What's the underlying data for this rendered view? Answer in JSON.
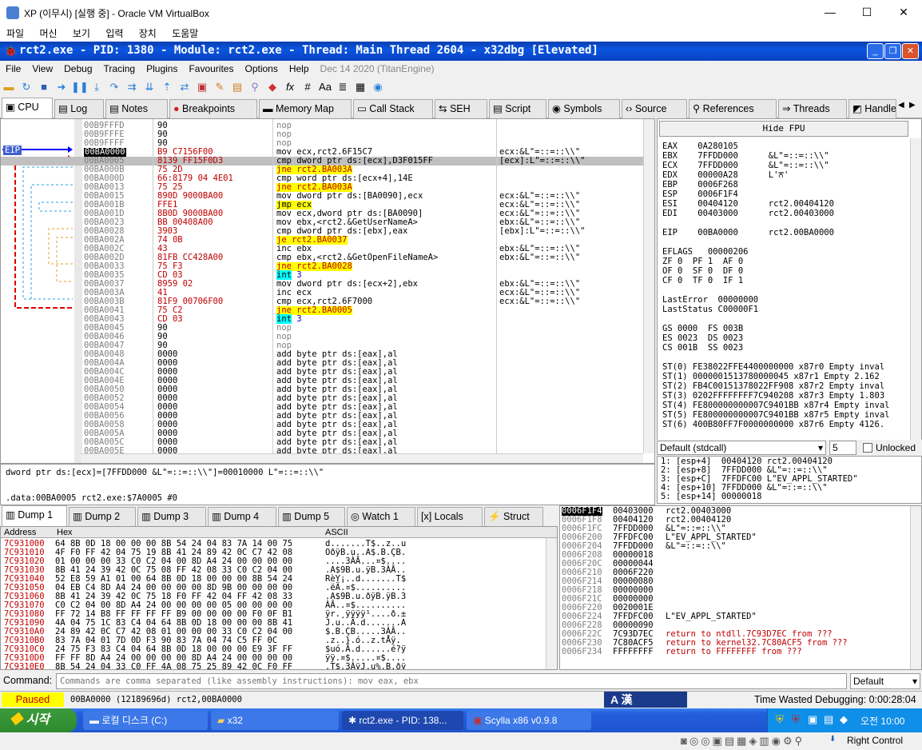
{
  "host": {
    "title": "XP (이무시) [실행 중] - Oracle VM VirtualBox",
    "menu": [
      "파일",
      "머신",
      "보기",
      "입력",
      "장치",
      "도움말"
    ]
  },
  "x64dbg": {
    "title": "rct2.exe - PID: 1380 - Module: rct2.exe - Thread: Main Thread 2604 - x32dbg [Elevated]",
    "menu": [
      "File",
      "View",
      "Debug",
      "Tracing",
      "Plugins",
      "Favourites",
      "Options",
      "Help"
    ],
    "date": "Dec 14 2020 (TitanEngine)"
  },
  "tabs": [
    "CPU",
    "Log",
    "Notes",
    "Breakpoints",
    "Memory Map",
    "Call Stack",
    "SEH",
    "Script",
    "Symbols",
    "Source",
    "References",
    "Threads",
    "Handles"
  ],
  "eip_label": "EIP",
  "disasm": [
    {
      "a": "00B9FFFD",
      "b": "90",
      "i": "nop",
      "c": ""
    },
    {
      "a": "00B9FFFE",
      "b": "90",
      "i": "nop",
      "c": ""
    },
    {
      "a": "00B9FFFF",
      "b": "90",
      "i": "nop",
      "c": ""
    },
    {
      "a": "00BA0000",
      "b": "B9 C7156F00",
      "i": "mov ecx,rct2.6F15C7",
      "c": "ecx:&L\"=::=::\\\\\""
    },
    {
      "a": "00BA0005",
      "b": "8139 FF15F0D3",
      "i": "cmp dword ptr ds:[ecx],D3F015FF",
      "c": "[ecx]:L\"=::=::\\\\\""
    },
    {
      "a": "00BA000B",
      "b": "75 2D",
      "i": "jne rct2.BA003A",
      "c": ""
    },
    {
      "a": "00BA000D",
      "b": "66:8179 04 4E01",
      "i": "cmp word ptr ds:[ecx+4],14E",
      "c": ""
    },
    {
      "a": "00BA0013",
      "b": "75 25",
      "i": "jne rct2.BA003A",
      "c": ""
    },
    {
      "a": "00BA0015",
      "b": "890D 9000BA00",
      "i": "mov dword ptr ds:[BA0090],ecx",
      "c": "ecx:&L\"=::=::\\\\\""
    },
    {
      "a": "00BA001B",
      "b": "FFE1",
      "i": "jmp ecx",
      "c": "ecx:&L\"=::=::\\\\\""
    },
    {
      "a": "00BA001D",
      "b": "8B0D 9000BA00",
      "i": "mov ecx,dword ptr ds:[BA0090]",
      "c": "ecx:&L\"=::=::\\\\\""
    },
    {
      "a": "00BA0023",
      "b": "BB 00408A00",
      "i": "mov ebx,<rct2.&GetUserNameA>",
      "c": "ebx:&L\"=::=::\\\\\""
    },
    {
      "a": "00BA0028",
      "b": "3903",
      "i": "cmp dword ptr ds:[ebx],eax",
      "c": "[ebx]:L\"=::=::\\\\\""
    },
    {
      "a": "00BA002A",
      "b": "74 0B",
      "i": "je rct2.BA0037",
      "c": ""
    },
    {
      "a": "00BA002C",
      "b": "43",
      "i": "inc ebx",
      "c": "ebx:&L\"=::=::\\\\\""
    },
    {
      "a": "00BA002D",
      "b": "81FB CC428A00",
      "i": "cmp ebx,<rct2.&GetOpenFileNameA>",
      "c": "ebx:&L\"=::=::\\\\\""
    },
    {
      "a": "00BA0033",
      "b": "75 F3",
      "i": "jne rct2.BA0028",
      "c": ""
    },
    {
      "a": "00BA0035",
      "b": "CD 03",
      "i": "int 3",
      "c": ""
    },
    {
      "a": "00BA0037",
      "b": "8959 02",
      "i": "mov dword ptr ds:[ecx+2],ebx",
      "c": "ebx:&L\"=::=::\\\\\""
    },
    {
      "a": "00BA003A",
      "b": "41",
      "i": "inc ecx",
      "c": "ecx:&L\"=::=::\\\\\""
    },
    {
      "a": "00BA003B",
      "b": "81F9 00706F00",
      "i": "cmp ecx,rct2.6F7000",
      "c": "ecx:&L\"=::=::\\\\\""
    },
    {
      "a": "00BA0041",
      "b": "75 C2",
      "i": "jne rct2.BA0005",
      "c": ""
    },
    {
      "a": "00BA0043",
      "b": "CD 03",
      "i": "int 3",
      "c": ""
    },
    {
      "a": "00BA0045",
      "b": "90",
      "i": "nop",
      "c": ""
    },
    {
      "a": "00BA0046",
      "b": "90",
      "i": "nop",
      "c": ""
    },
    {
      "a": "00BA0047",
      "b": "90",
      "i": "nop",
      "c": ""
    },
    {
      "a": "00BA0048",
      "b": "0000",
      "i": "add byte ptr ds:[eax],al",
      "c": ""
    },
    {
      "a": "00BA004A",
      "b": "0000",
      "i": "add byte ptr ds:[eax],al",
      "c": ""
    },
    {
      "a": "00BA004C",
      "b": "0000",
      "i": "add byte ptr ds:[eax],al",
      "c": ""
    },
    {
      "a": "00BA004E",
      "b": "0000",
      "i": "add byte ptr ds:[eax],al",
      "c": ""
    },
    {
      "a": "00BA0050",
      "b": "0000",
      "i": "add byte ptr ds:[eax],al",
      "c": ""
    },
    {
      "a": "00BA0052",
      "b": "0000",
      "i": "add byte ptr ds:[eax],al",
      "c": ""
    },
    {
      "a": "00BA0054",
      "b": "0000",
      "i": "add byte ptr ds:[eax],al",
      "c": ""
    },
    {
      "a": "00BA0056",
      "b": "0000",
      "i": "add byte ptr ds:[eax],al",
      "c": ""
    },
    {
      "a": "00BA0058",
      "b": "0000",
      "i": "add byte ptr ds:[eax],al",
      "c": ""
    },
    {
      "a": "00BA005A",
      "b": "0000",
      "i": "add byte ptr ds:[eax],al",
      "c": ""
    },
    {
      "a": "00BA005C",
      "b": "0000",
      "i": "add byte ptr ds:[eax],al",
      "c": ""
    },
    {
      "a": "00BA005E",
      "b": "0000",
      "i": "add byte ptr ds:[eax],al",
      "c": ""
    }
  ],
  "registers": {
    "hide_fpu": "Hide FPU",
    "lines": [
      "EAX    0A280105",
      "EBX    7FFDD000      &L\"=::=::\\\\\"",
      "ECX    7FFDD000      &L\"=::=::\\\\\"",
      "EDX    00000A28      L'ਨ'",
      "EBP    0006F268",
      "ESP    0006F1F4",
      "ESI    00404120      rct2.00404120",
      "EDI    00403000      rct2.00403000",
      "",
      "EIP    00BA0000      rct2.00BA0000",
      "",
      "EFLAGS   00000206",
      "ZF 0  PF 1  AF 0",
      "OF 0  SF 0  DF 0",
      "CF 0  TF 0  IF 1",
      "",
      "LastError  00000000",
      "LastStatus C00000F1",
      "",
      "GS 0000  FS 003B",
      "ES 0023  DS 0023",
      "CS 001B  SS 0023",
      "",
      "ST(0) FE38022FFE4400000000 x87r0 Empty inval",
      "ST(1) 0000001513780000045 x87r1 Empty 2.162",
      "ST(2) FB4C00151378022FF908 x87r2 Empty inval",
      "ST(3) 0202FFFFFFFF7C940208 x87r3 Empty 1.803",
      "ST(4) FE800000000007C9401BB x87r4 Empty inval",
      "ST(5) FE800000000007C9401BB x87r5 Empty inval",
      "ST(6) 400B80FF7F0000000000 x87r6 Empty 4126."
    ]
  },
  "callconv": {
    "value": "Default (stdcall)",
    "count": "5",
    "unlocked": "Unlocked"
  },
  "stackargs": [
    "1: [esp+4]  00404120 rct2.00404120",
    "2: [esp+8]  7FFDD000 &L\"=::=::\\\\\"",
    "3: [esp+C]  7FFDFC00 L\"EV_APPL_STARTED\"",
    "4: [esp+10] 7FFDD000 &L\"=::=::\\\\\"",
    "5: [esp+14] 00000018"
  ],
  "info": [
    "dword ptr ds:[ecx]=[7FFDD000 &L\"=::=::\\\\\"]=00010000 L\"=::=::\\\\\"",
    "",
    ".data:00BA0005 rct2.exe:$7A0005 #0"
  ],
  "dumptabs": [
    "Dump 1",
    "Dump 2",
    "Dump 3",
    "Dump 4",
    "Dump 5",
    "Watch 1",
    "Locals",
    "Struct"
  ],
  "dump": {
    "h_addr": "Address",
    "h_hex": "Hex",
    "h_ascii": "ASCII",
    "rows": [
      {
        "a": "7C931000",
        "h": "64 8B 0D 18 00 00 00 8B 54 24 04 83 7A 14 00 75",
        "s": "d.......T$..z..u"
      },
      {
        "a": "7C931010",
        "h": "4F F0 FF 42 04 75 19 8B 41 24 89 42 0C C7 42 08",
        "s": "OðÿB.u..A$.B.ÇB."
      },
      {
        "a": "7C931020",
        "h": "01 00 00 00 33 C0 C2 04 00 8D A4 24 00 00 00 00",
        "s": "....3ÀÂ...¤$...."
      },
      {
        "a": "7C931030",
        "h": "8B 41 24 39 42 0C 75 08 FF 42 08 33 C0 C2 04 00",
        "s": ".A$9B.u.ÿB.3ÀÂ.."
      },
      {
        "a": "7C931040",
        "h": "52 E8 59 A1 01 00 64 8B 0D 18 00 00 00 8B 54 24",
        "s": "RèY¡..d.......T$"
      },
      {
        "a": "7C931050",
        "h": "04 EB C4 8D A4 24 00 00 00 00 8D 9B 00 00 00 00",
        "s": ".ëÄ.¤$.........."
      },
      {
        "a": "7C931060",
        "h": "8B 41 24 39 42 0C 75 18 F0 FF 42 04 FF 42 08 33",
        "s": ".A$9B.u.ðÿB.ÿB.3"
      },
      {
        "a": "7C931070",
        "h": "C0 C2 04 00 8D A4 24 00 00 00 00 05 00 00 00 00",
        "s": "ÀÂ..¤$.........."
      },
      {
        "a": "7C931080",
        "h": "FF 72 14 B8 FF FF FF FF B9 00 00 00 00 F0 0F B1",
        "s": "ÿr.¸ÿÿÿÿ¹....ð.±"
      },
      {
        "a": "7C931090",
        "h": "4A 04 75 1C 83 C4 04 64 8B 0D 18 00 00 00 8B 41",
        "s": "J.u..Ä.d.......A"
      },
      {
        "a": "7C9310A0",
        "h": "24 89 42 0C C7 42 08 01 00 00 00 33 C0 C2 04 00",
        "s": "$.B.ÇB.....3ÀÂ.."
      },
      {
        "a": "7C9310B0",
        "h": "83 7A 04 01 7D 0D F3 90 83 7A 04 74 C5 FF 0C",
        "s": ".z..}.ó..z.tÅÿ."
      },
      {
        "a": "7C9310C0",
        "h": "24 75 F3 83 C4 04 64 8B 0D 18 00 00 00 E9 3F FF",
        "s": "$uó.Ä.d......é?ÿ"
      },
      {
        "a": "7C9310D0",
        "h": "FF FF 8D A4 24 00 00 00 00 8D A4 24 00 00 00 00",
        "s": "ÿÿ.¤$.....¤$...."
      },
      {
        "a": "7C9310E0",
        "h": "8B 54 24 04 33 C0 FF 4A 08 75 25 89 42 0C F0 FF",
        "s": ".T$.3ÀÿJ.u%.B.ðÿ"
      }
    ]
  },
  "stack": [
    {
      "a": "0006F1F4",
      "v": "00403000",
      "c": "rct2.00403000"
    },
    {
      "a": "0006F1F8",
      "v": "00404120",
      "c": "rct2.00404120"
    },
    {
      "a": "0006F1FC",
      "v": "7FFDD000",
      "c": "&L\"=::=::\\\\\""
    },
    {
      "a": "0006F200",
      "v": "7FFDFC00",
      "c": "L\"EV_APPL_STARTED\""
    },
    {
      "a": "0006F204",
      "v": "7FFDD000",
      "c": "&L\"=::=::\\\\\""
    },
    {
      "a": "0006F208",
      "v": "00000018",
      "c": ""
    },
    {
      "a": "0006F20C",
      "v": "00000044",
      "c": ""
    },
    {
      "a": "0006F210",
      "v": "0006F220",
      "c": ""
    },
    {
      "a": "0006F214",
      "v": "00000080",
      "c": ""
    },
    {
      "a": "0006F218",
      "v": "00000000",
      "c": ""
    },
    {
      "a": "0006F21C",
      "v": "00000000",
      "c": ""
    },
    {
      "a": "0006F220",
      "v": "0020001E",
      "c": ""
    },
    {
      "a": "0006F224",
      "v": "7FFDFC00",
      "c": "L\"EV_APPL_STARTED\""
    },
    {
      "a": "0006F228",
      "v": "00000090",
      "c": ""
    },
    {
      "a": "0006F22C",
      "v": "7C93D7EC",
      "c": "return to ntdll.7C93D7EC from ???"
    },
    {
      "a": "0006F230",
      "v": "7C80ACF5",
      "c": "return to kernel32.7C80ACF5 from ???"
    },
    {
      "a": "0006F234",
      "v": "FFFFFFFF",
      "c": "return to FFFFFFFF from ???"
    }
  ],
  "command": {
    "label": "Command:",
    "placeholder": "Commands are comma separated (like assembly instructions): mov eax, ebx",
    "mode": "Default"
  },
  "status": {
    "state": "Paused",
    "text": "00BA0000 (12189696d) rct2,00BA0000",
    "ime": "A 漢",
    "time": "Time Wasted Debugging: 0:00:28:04"
  },
  "taskbar": {
    "start": "시작",
    "items": [
      "로컬 디스크 (C:)",
      "x32",
      "rct2.exe - PID: 138...",
      "Scylla x86 v0.9.8"
    ],
    "clock": "오전 10:00"
  },
  "vbox": {
    "right_control": "Right Control"
  }
}
